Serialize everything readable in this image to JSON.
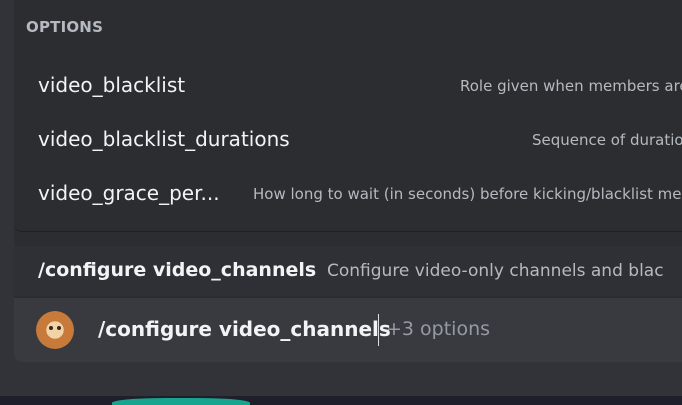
{
  "options_header": "OPTIONS",
  "options": [
    {
      "name": "video_blacklist",
      "description": "Role given when members are"
    },
    {
      "name": "video_blacklist_durations",
      "description": "Sequence of duratio"
    },
    {
      "name": "video_grace_per...",
      "description": "How long to wait (in seconds) before kicking/blacklist me"
    }
  ],
  "command": {
    "name": "/configure video_channels",
    "description": "Configure video-only channels and blac"
  },
  "input": {
    "command": "/configure video_channels",
    "hint": "+3 options"
  },
  "colors": {
    "background": "#313338",
    "panel": "#2b2d31",
    "selected_row": "#2e3035",
    "input_row": "#383a40",
    "text": "#f2f3f5",
    "muted_text": "#b5bac1"
  }
}
